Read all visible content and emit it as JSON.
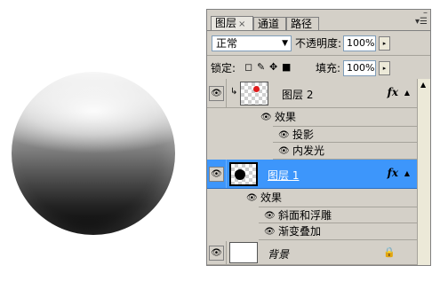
{
  "tabs": [
    {
      "label": "图层",
      "close": "×"
    },
    {
      "label": "通道"
    },
    {
      "label": "路径"
    }
  ],
  "panel_controls": {
    "minimize": "–",
    "menu": "▾☰"
  },
  "blend_mode": "正常",
  "opacity_label": "不透明度:",
  "opacity_value": "100%",
  "lock_label": "锁定:",
  "fill_label": "填充:",
  "fill_value": "100%",
  "layers": [
    {
      "name": "图层 2",
      "fx": "fx",
      "effects_label": "效果",
      "effects": [
        "投影",
        "内发光"
      ]
    },
    {
      "name": "图层 1",
      "fx": "fx",
      "effects_label": "效果",
      "effects": [
        "斜面和浮雕",
        "渐变叠加"
      ]
    },
    {
      "name": "背景"
    }
  ],
  "colors": {
    "panel_bg": "#d4d0c8",
    "selected_row": "#3d96fb",
    "thumb_dot_red": "#e11d1d"
  }
}
